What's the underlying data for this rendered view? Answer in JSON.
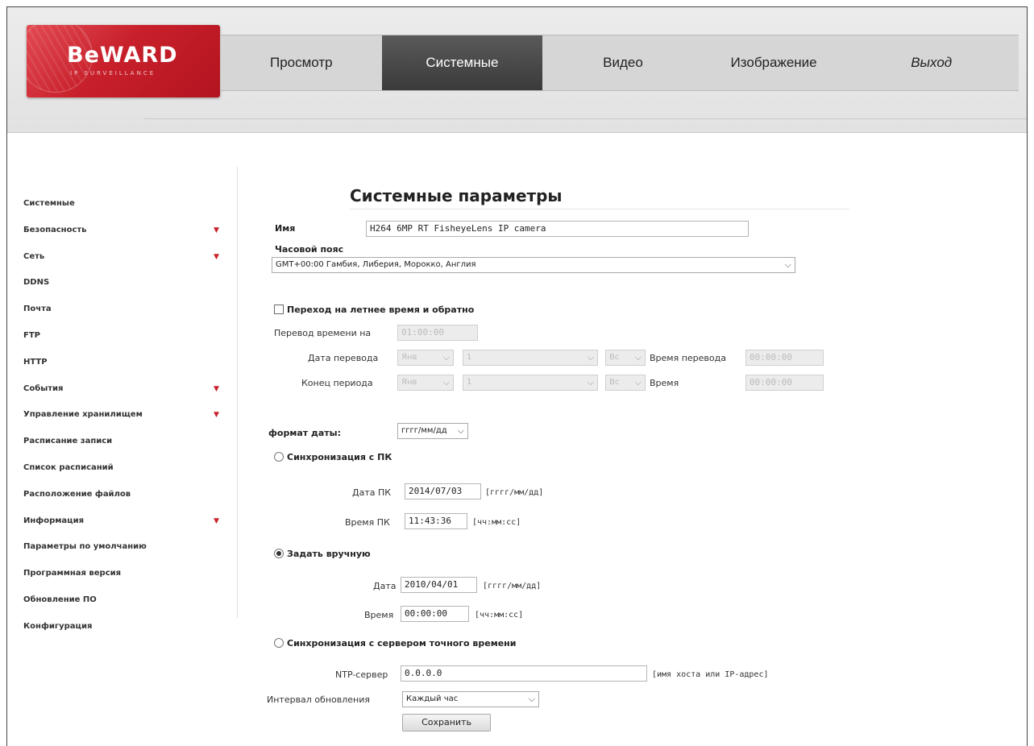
{
  "brand": {
    "name": "BeWARD",
    "tagline": "IP SURVEILLANCE"
  },
  "nav": {
    "tabs": [
      {
        "label": "Просмотр"
      },
      {
        "label": "Системные"
      },
      {
        "label": "Видео"
      },
      {
        "label": "Изображение"
      },
      {
        "label": "Выход"
      }
    ],
    "active": "Системные"
  },
  "sidebar": {
    "items": [
      {
        "label": "Системные",
        "has_submenu": false
      },
      {
        "label": "Безопасность",
        "has_submenu": true
      },
      {
        "label": "Сеть",
        "has_submenu": true
      },
      {
        "label": "DDNS",
        "has_submenu": false
      },
      {
        "label": "Почта",
        "has_submenu": false
      },
      {
        "label": "FTP",
        "has_submenu": false
      },
      {
        "label": "HTTP",
        "has_submenu": false
      },
      {
        "label": "События",
        "has_submenu": true
      },
      {
        "label": "Управление хранилищем",
        "has_submenu": true
      },
      {
        "label": "Расписание записи",
        "has_submenu": false
      },
      {
        "label": "Список расписаний",
        "has_submenu": false
      },
      {
        "label": "Расположение файлов",
        "has_submenu": false
      },
      {
        "label": "Информация",
        "has_submenu": true
      },
      {
        "label": "Параметры по умолчанию",
        "has_submenu": false
      },
      {
        "label": "Программная версия",
        "has_submenu": false
      },
      {
        "label": "Обновление ПО",
        "has_submenu": false
      },
      {
        "label": "Конфигурация",
        "has_submenu": false
      }
    ],
    "submenu_arrow": "▼"
  },
  "main": {
    "title": "Системные параметры",
    "name_label": "Имя",
    "name_value": "H264 6MP RT FisheyeLens IP camera",
    "timezone_label": "Часовой пояс",
    "timezone_value": "GMT+00:00 Гамбия, Либерия, Морокко, Англия",
    "dst": {
      "label": "Переход на летнее время и обратно",
      "checked": false,
      "shift_label": "Перевод времени на",
      "shift_value": "01:00:00",
      "start_label": "Дата перевода",
      "start_month": "Янв",
      "start_week": "1",
      "start_day": "Вс",
      "start_time_label": "Время перевода",
      "start_time": "00:00:00",
      "end_label": "Конец периода",
      "end_month": "Янв",
      "end_week": "1",
      "end_day": "Вс",
      "end_time_label": "Время",
      "end_time": "00:00:00"
    },
    "date_format_label": "формат даты:",
    "date_format_value": "гггг/мм/дд",
    "sync_pc": {
      "label": "Синхронизация с ПК",
      "selected": false,
      "date_label": "Дата ПК",
      "date_value": "2014/07/03",
      "date_hint": "[гггг/мм/дд]",
      "time_label": "Время ПК",
      "time_value": "11:43:36",
      "time_hint": "[чч:мм:сс]"
    },
    "manual": {
      "label": "Задать вручную",
      "selected": true,
      "date_label": "Дата",
      "date_value": "2010/04/01",
      "date_hint": "[гггг/мм/дд]",
      "time_label": "Время",
      "time_value": "00:00:00",
      "time_hint": "[чч:мм:сс]"
    },
    "ntp": {
      "label": "Синхронизация с сервером точного времени",
      "selected": false,
      "server_label": "NTP-сервер",
      "server_value": "0.0.0.0",
      "server_hint": "[имя хоста или IP-адрес]",
      "interval_label": "Интервал обновления",
      "interval_value": "Каждый час"
    },
    "save_label": "Сохранить"
  },
  "icons": {
    "select_chevron": "chevron-down-icon",
    "chevron_glyph": "⌵"
  },
  "colors": {
    "brand_red": "#c8202b",
    "active_tab": "#444444",
    "header_bg": "#e4e4e4"
  }
}
